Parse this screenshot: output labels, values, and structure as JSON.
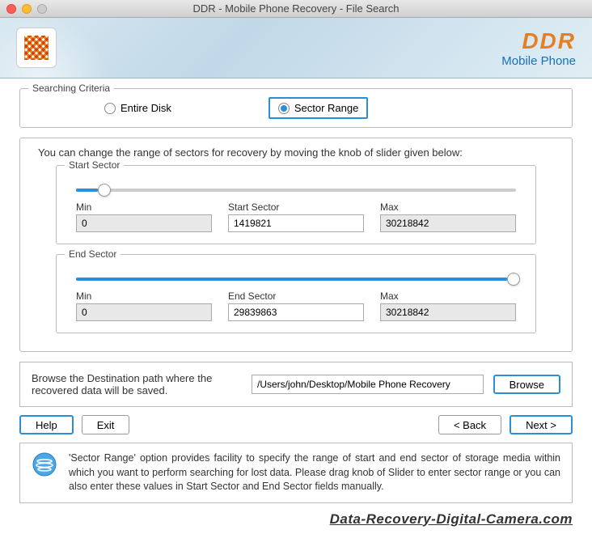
{
  "window": {
    "title": "DDR - Mobile Phone Recovery - File Search"
  },
  "brand": {
    "name": "DDR",
    "sub": "Mobile Phone"
  },
  "criteria": {
    "legend": "Searching Criteria",
    "opt1": "Entire Disk",
    "opt2": "Sector Range"
  },
  "range": {
    "instruction": "You can change the range of sectors for recovery by moving the knob of slider given below:",
    "start": {
      "legend": "Start Sector",
      "min_label": "Min",
      "min": "0",
      "val_label": "Start Sector",
      "val": "1419821",
      "max_label": "Max",
      "max": "30218842",
      "pct": 5
    },
    "end": {
      "legend": "End Sector",
      "min_label": "Min",
      "min": "0",
      "val_label": "End Sector",
      "val": "29839863",
      "max_label": "Max",
      "max": "30218842",
      "pct": 98
    }
  },
  "dest": {
    "label": "Browse the Destination path where the recovered data will be saved.",
    "path": "/Users/john/Desktop/Mobile Phone Recovery",
    "browse": "Browse"
  },
  "buttons": {
    "help": "Help",
    "exit": "Exit",
    "back": "< Back",
    "next": "Next >"
  },
  "info": "'Sector Range' option provides facility to specify the range of start and end sector of storage media within which you want to perform searching for lost data. Please drag knob of Slider to enter sector range or you can also enter these values in Start Sector and End Sector fields manually.",
  "watermark": "Data-Recovery-Digital-Camera.com"
}
